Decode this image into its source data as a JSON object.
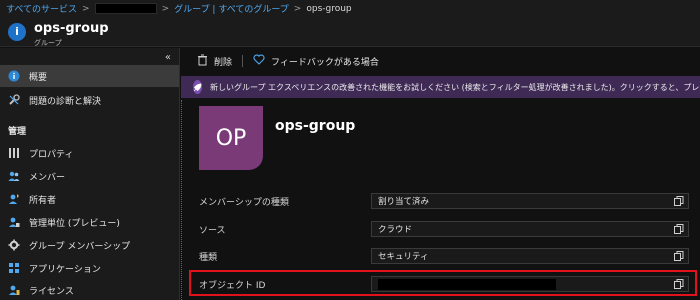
{
  "breadcrumb": {
    "home": "すべてのサービス",
    "groups": "グループ | すべてのグループ",
    "current": "ops-group"
  },
  "header": {
    "title": "ops-group",
    "subtitle": "グループ"
  },
  "sidebar": {
    "collapse": "«",
    "items": [
      {
        "label": "概要",
        "icon": "info-icon",
        "active": true
      },
      {
        "label": "問題の診断と解決",
        "icon": "wrench-icon",
        "active": false
      }
    ],
    "section_title": "管理",
    "manage_items": [
      {
        "label": "プロパティ",
        "icon": "properties-icon"
      },
      {
        "label": "メンバー",
        "icon": "members-icon"
      },
      {
        "label": "所有者",
        "icon": "owners-icon"
      },
      {
        "label": "管理単位 (プレビュー)",
        "icon": "admin-units-icon"
      },
      {
        "label": "グループ メンバーシップ",
        "icon": "gear-icon"
      },
      {
        "label": "アプリケーション",
        "icon": "apps-icon"
      },
      {
        "label": "ライセンス",
        "icon": "license-icon"
      }
    ]
  },
  "toolbar": {
    "delete_label": "削除",
    "feedback_label": "フィードバックがある場合"
  },
  "banner": {
    "text": "新しいグループ エクスペリエンスの改善された機能をお試しください (検索とフィルター処理が改善されました)。クリックすると、プレビューが有効になります"
  },
  "overview": {
    "tile_initials": "OP",
    "group_name": "ops-group",
    "properties": [
      {
        "label": "メンバーシップの種類",
        "value": "割り当て済み"
      },
      {
        "label": "ソース",
        "value": "クラウド"
      },
      {
        "label": "種類",
        "value": "セキュリティ"
      },
      {
        "label": "オブジェクト ID",
        "value": ""
      }
    ]
  },
  "colors": {
    "accent": "#1e73c8",
    "tile": "#7a3a78",
    "banner": "#3e2a55",
    "highlight": "#e0121b"
  }
}
